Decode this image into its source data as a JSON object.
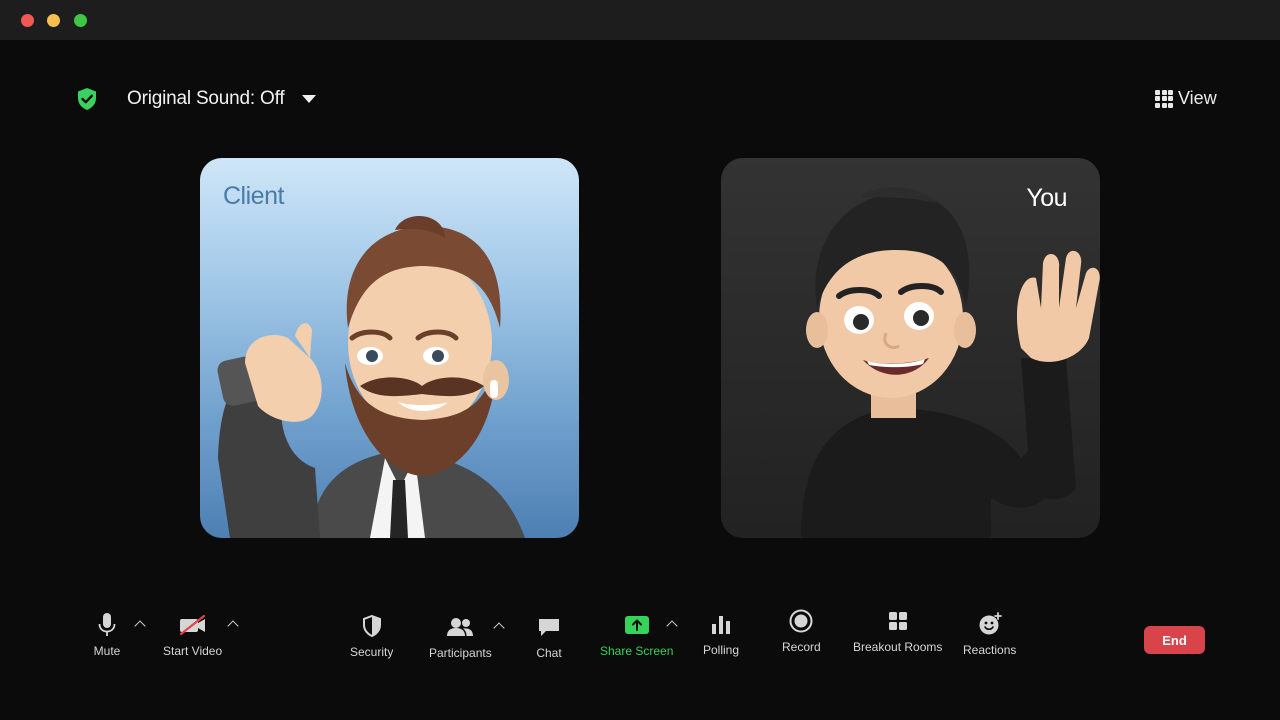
{
  "window": {
    "title": ""
  },
  "header": {
    "sound_label": "Original Sound: Off",
    "view_label": "View"
  },
  "participants": [
    {
      "name": "Client",
      "background": "#8fb8dc"
    },
    {
      "name": "You",
      "background": "#2c2c2c"
    }
  ],
  "toolbar": {
    "mute": "Mute",
    "start_video": "Start Video",
    "security": "Security",
    "participants": "Participants",
    "chat": "Chat",
    "share_screen": "Share Screen",
    "polling": "Polling",
    "record": "Record",
    "breakout_rooms": "Breakout Rooms",
    "reactions": "Reactions",
    "end": "End"
  },
  "colors": {
    "accent_green": "#35d35c",
    "end_red": "#d9434a",
    "background": "#0b0b0b"
  },
  "icons": [
    "shield-check-icon",
    "caret-down-icon",
    "grid-icon",
    "microphone-icon",
    "video-off-icon",
    "security-shield-icon",
    "participants-icon",
    "chat-icon",
    "share-screen-icon",
    "polling-icon",
    "record-icon",
    "breakout-rooms-icon",
    "reactions-icon"
  ]
}
